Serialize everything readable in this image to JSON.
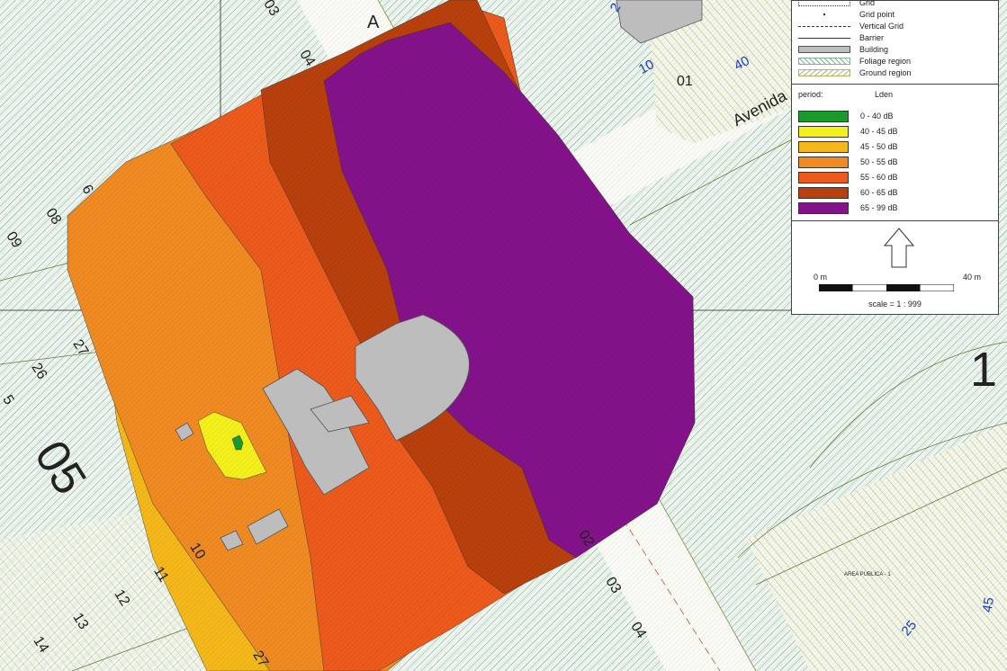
{
  "map": {
    "street_label": "Avenida",
    "block_label_a": "05",
    "block_label_b": "1",
    "area_label": "AREA PUBLICA - 1",
    "lot_numbers": [
      "03",
      "04",
      "08",
      "09",
      "27",
      "26",
      "5",
      "10",
      "11",
      "12",
      "13",
      "14",
      "27",
      "02",
      "03",
      "04",
      "01",
      "6"
    ],
    "blue_lot_numbers": [
      "10",
      "40",
      "25",
      "45",
      "2"
    ],
    "top_letter": "A",
    "colors": {
      "foliage_hatch": "#7fb38f",
      "ground_hatch": "#a9b96a",
      "building": "#bdbdbd",
      "road_line": "#c86d6d"
    }
  },
  "legend": {
    "keys": [
      {
        "label": "Grid",
        "symbol": "grid"
      },
      {
        "label": "Grid point",
        "symbol": "grid-point"
      },
      {
        "label": "Vertical Grid",
        "symbol": "vertical-grid"
      },
      {
        "label": "Barrier",
        "symbol": "barrier"
      },
      {
        "label": "Building",
        "symbol": "building"
      },
      {
        "label": "Foliage region",
        "symbol": "foliage"
      },
      {
        "label": "Ground region",
        "symbol": "ground"
      }
    ],
    "period_label": "period:",
    "period_value": "Lden",
    "bands": [
      {
        "label": "0 - 40 dB",
        "color": "#1a9a2a"
      },
      {
        "label": "40 - 45 dB",
        "color": "#f4f01c"
      },
      {
        "label": "45 - 50 dB",
        "color": "#f5b81a"
      },
      {
        "label": "50 - 55 dB",
        "color": "#f08a22"
      },
      {
        "label": "55 - 60 dB",
        "color": "#ec5a1c"
      },
      {
        "label": "60 - 65 dB",
        "color": "#b8400c"
      },
      {
        "label": "65 - 99 dB",
        "color": "#84128a"
      }
    ],
    "scale_start": "0 m",
    "scale_end": "40 m",
    "scale_text": "scale = 1 : 999",
    "north_icon": "north-arrow-icon"
  }
}
